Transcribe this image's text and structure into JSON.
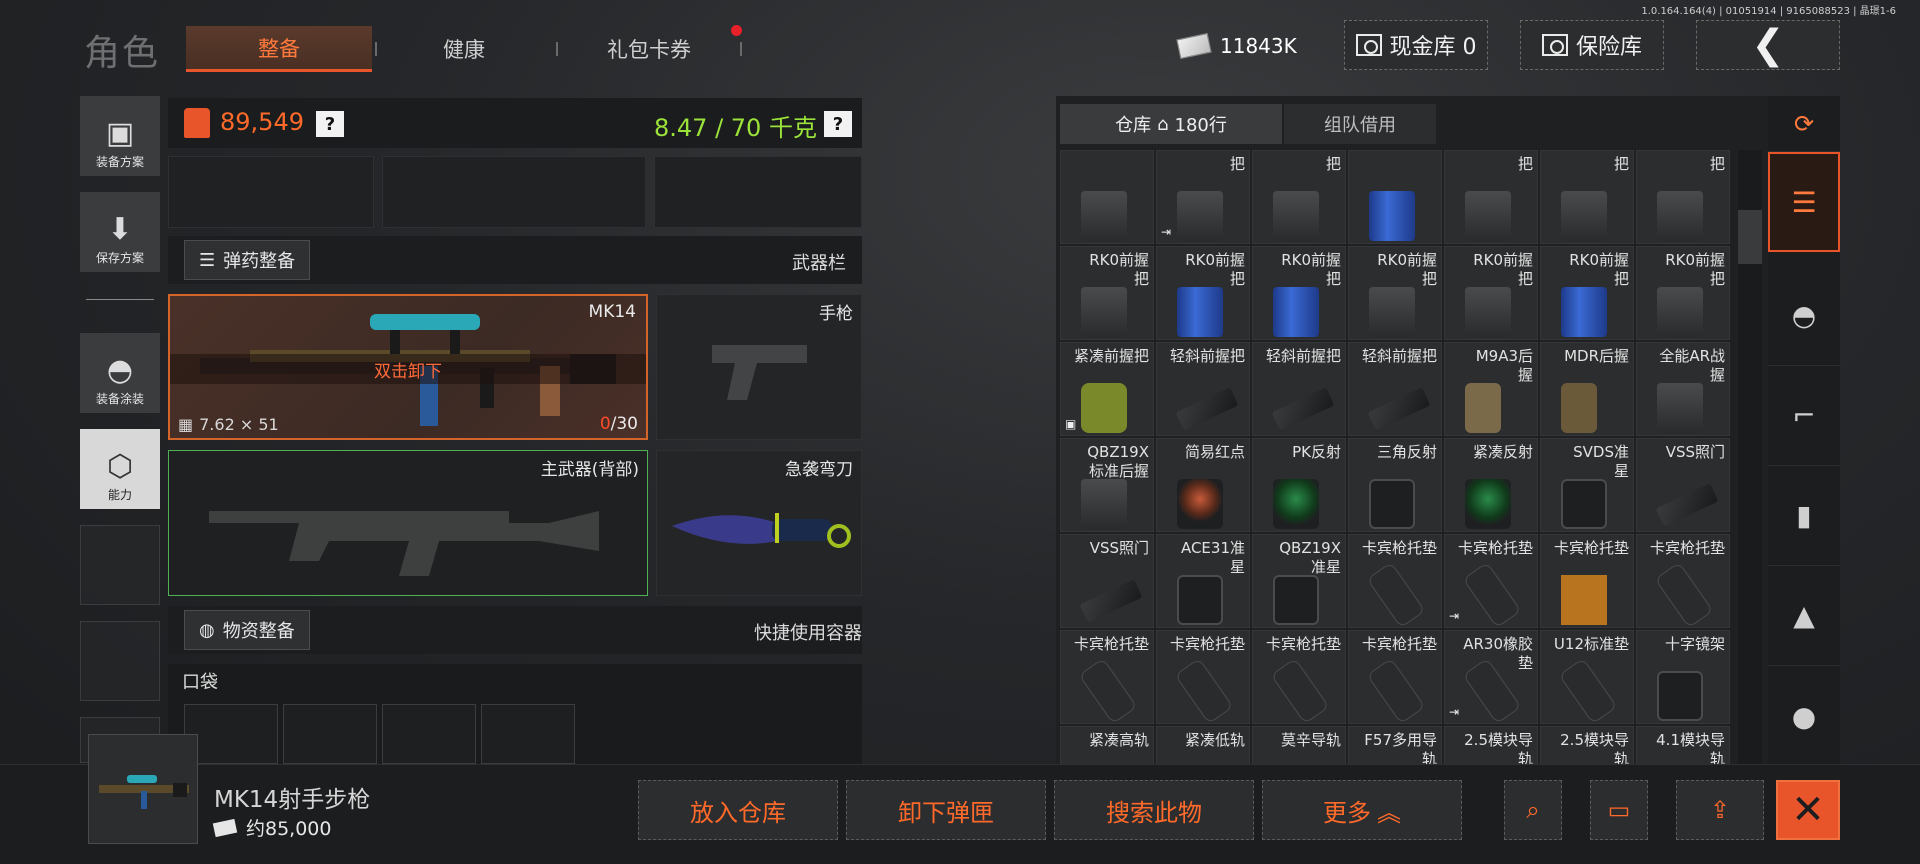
{
  "version": "1.0.164.164(4) | 01051914 | 9165088523 | 晶璟1-6",
  "header": {
    "title": "角色",
    "tabs": [
      {
        "label": "整备",
        "active": true
      },
      {
        "label": "健康"
      },
      {
        "label": "礼包卡券",
        "has_dot": true
      }
    ],
    "money": "11843K",
    "cash_vault_label": "现金库 0",
    "insurance_label": "保险库",
    "back_icon": "chevron-left-icon"
  },
  "side_menu": [
    {
      "label": "装备方案",
      "icon": "vest-icon"
    },
    {
      "label": "保存方案",
      "icon": "download-icon"
    },
    {
      "label": "装备涂装",
      "icon": "helmet-icon"
    },
    {
      "label": "能力",
      "icon": "lightning-hexagon-icon",
      "active": true
    }
  ],
  "loadout": {
    "value": "89,549",
    "weight": "8.47 / 70 千克",
    "help": "?",
    "ammo_section_label": "弹药整备",
    "weapon_bar_label": "武器栏",
    "supplies_section_label": "物资整备",
    "quick_container_label": "快捷使用容器",
    "pocket_label": "口袋",
    "weapon_main": {
      "name": "MK14",
      "hint": "双击卸下",
      "caliber": "7.62 × 51",
      "ammo_loaded": "0",
      "ammo_capacity": "/30"
    },
    "pistol_label": "手枪",
    "primary_back_label": "主武器(背部)",
    "melee_label": "急袭弯刀"
  },
  "warehouse": {
    "tab_warehouse": "仓库",
    "rows": "180行",
    "tab_team": "组队借用",
    "items": [
      {
        "name": "",
        "art": "grip"
      },
      {
        "name": "把",
        "art": "grip",
        "arrow": true
      },
      {
        "name": "把",
        "art": "grip"
      },
      {
        "name": "",
        "art": "grip-blue"
      },
      {
        "name": "把",
        "art": "grip"
      },
      {
        "name": "把",
        "art": "grip"
      },
      {
        "name": "把",
        "art": "grip"
      },
      {
        "name": "RK0前握\n把",
        "art": "grip"
      },
      {
        "name": "RK0前握\n把",
        "art": "grip-blue"
      },
      {
        "name": "RK0前握\n把",
        "art": "grip-blue"
      },
      {
        "name": "RK0前握\n把",
        "art": "grip"
      },
      {
        "name": "RK0前握\n把",
        "art": "grip"
      },
      {
        "name": "RK0前握\n把",
        "art": "grip-blue"
      },
      {
        "name": "RK0前握\n把",
        "art": "grip"
      },
      {
        "name": "紧凑前握把",
        "art": "green",
        "box": true
      },
      {
        "name": "轻斜前握把",
        "art": "rail"
      },
      {
        "name": "轻斜前握把",
        "art": "rail"
      },
      {
        "name": "轻斜前握把",
        "art": "rail"
      },
      {
        "name": "M9A3后\n握",
        "art": "tan"
      },
      {
        "name": "MDR后握",
        "art": "brown"
      },
      {
        "name": "全能AR战\n握",
        "art": "grip"
      },
      {
        "name": "QBZ19X\n标准后握",
        "art": "grip"
      },
      {
        "name": "简易红点",
        "art": "sight-red"
      },
      {
        "name": "PK反射",
        "art": "sight-green"
      },
      {
        "name": "三角反射",
        "art": "sight"
      },
      {
        "name": "紧凑反射",
        "art": "sight-green"
      },
      {
        "name": "SVDS准\n星",
        "art": "sight"
      },
      {
        "name": "VSS照门",
        "art": "rail"
      },
      {
        "name": "VSS照门",
        "art": "rail"
      },
      {
        "name": "ACE31准\n星",
        "art": "sight"
      },
      {
        "name": "QBZ19X\n准星",
        "art": "sight"
      },
      {
        "name": "卡宾枪托垫",
        "art": "pad"
      },
      {
        "name": "卡宾枪托垫",
        "art": "pad",
        "arrow": true
      },
      {
        "name": "卡宾枪托垫",
        "art": "pad-orange"
      },
      {
        "name": "卡宾枪托垫",
        "art": "pad"
      },
      {
        "name": "卡宾枪托垫",
        "art": "pad"
      },
      {
        "name": "卡宾枪托垫",
        "art": "pad"
      },
      {
        "name": "卡宾枪托垫",
        "art": "pad"
      },
      {
        "name": "卡宾枪托垫",
        "art": "pad"
      },
      {
        "name": "AR30橡胶\n垫",
        "art": "pad",
        "arrow": true
      },
      {
        "name": "U12标准垫",
        "art": "pad"
      },
      {
        "name": "十字镜架",
        "art": "sight"
      },
      {
        "name": "紧凑高轨",
        "art": "rail"
      },
      {
        "name": "紧凑低轨",
        "art": "rail"
      },
      {
        "name": "莫辛导轨",
        "art": "spinner"
      },
      {
        "name": "F57多用导\n轨",
        "art": "rail"
      },
      {
        "name": "2.5模块导\n轨",
        "art": "rail"
      },
      {
        "name": "2.5模块导\n轨",
        "art": "rail"
      },
      {
        "name": "4.1模块导\n轨",
        "art": "rail"
      }
    ]
  },
  "filters": [
    {
      "icon": "sort-refresh-icon"
    },
    {
      "icon": "all-layers-icon",
      "active": true
    },
    {
      "icon": "helmet-icon"
    },
    {
      "icon": "rifle-icon"
    },
    {
      "icon": "magazine-icon"
    },
    {
      "icon": "bullet-icon"
    }
  ],
  "selection": {
    "name": "MK14射手步枪",
    "price": "约85,000"
  },
  "actions": {
    "store": "放入仓库",
    "unload_mag": "卸下弹匣",
    "search_item": "搜索此物",
    "more": "更多",
    "close": "✕"
  },
  "colors": {
    "accent": "#e8552a",
    "value": "#ff6a2a",
    "weight": "#9be23a",
    "primary_slot_border": "#4fb055"
  }
}
